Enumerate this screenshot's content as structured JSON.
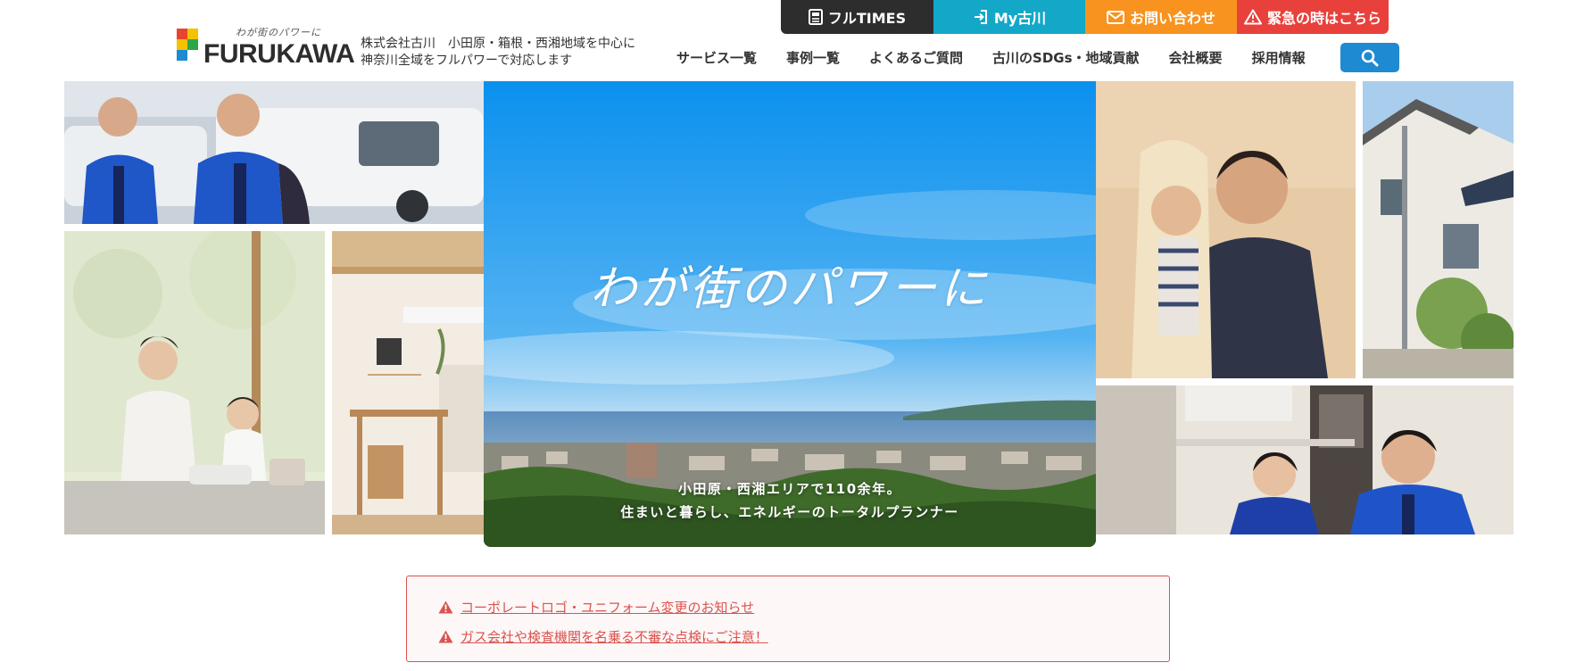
{
  "header": {
    "logo": {
      "tagline": "わが街のパワーに",
      "name": "FURUKAWA",
      "colors": [
        "#e8452c",
        "#f5c200",
        "#1e8ad2",
        "#2aa845"
      ]
    },
    "company_desc": {
      "line1": "株式会社古川　小田原・箱根・西湘地域を中心に",
      "line2": "神奈川全域をフルパワーで対応します"
    },
    "top_buttons": [
      {
        "label": "フルTIMES",
        "icon": "newspaper-icon",
        "color": "#2d2d2d"
      },
      {
        "label": "My古川",
        "icon": "login-icon",
        "color": "#13a8c8"
      },
      {
        "label": "お問い合わせ",
        "icon": "mail-icon",
        "color": "#f7931e"
      },
      {
        "label": "緊急の時はこちら",
        "icon": "warning-icon",
        "color": "#e8413c"
      }
    ],
    "nav": [
      "サービス一覧",
      "事例一覧",
      "よくあるご質問",
      "古川のSDGs・地域貢献",
      "会社概要",
      "採用情報"
    ],
    "search": {
      "icon": "search-icon",
      "color": "#1e8ad2"
    }
  },
  "hero": {
    "catchcopy": "わが街のパワーに",
    "sub_line1": "小田原・西湘エリアで110余年。",
    "sub_line2": "住まいと暮らし、エネルギーのトータルプランナー"
  },
  "notices": [
    {
      "text": "コーポレートロゴ・ユニフォーム変更のお知らせ",
      "icon": "warning-icon"
    },
    {
      "text": "ガス会社や検査機関を名乗る不審な点検にご注意！",
      "icon": "warning-icon"
    }
  ],
  "colors": {
    "notice_red": "#d9534f",
    "sky_blue": "#1a9bf0"
  }
}
